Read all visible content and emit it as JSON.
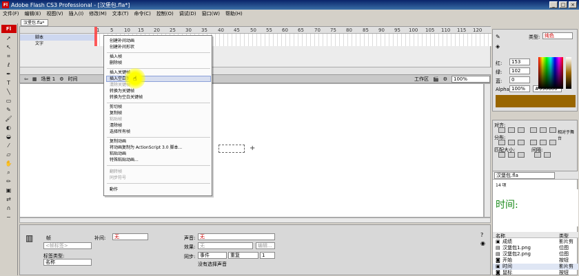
{
  "app": {
    "title": "Adobe Flash CS3 Professional - [汉堡包.fla*]",
    "logo": "Fl",
    "window_buttons": [
      "_",
      "□",
      "×"
    ]
  },
  "menubar": [
    "文件(F)",
    "编辑(E)",
    "视图(V)",
    "插入(I)",
    "修改(M)",
    "文本(T)",
    "命令(C)",
    "控制(O)",
    "调试(D)",
    "窗口(W)",
    "帮助(H)"
  ],
  "document_tab": "汉堡包.fla*",
  "timeline": {
    "frame_numbers": [
      "1",
      "5",
      "10",
      "15",
      "20",
      "25",
      "30",
      "35",
      "40",
      "45",
      "50",
      "55",
      "60",
      "65",
      "70",
      "75",
      "80",
      "85",
      "90",
      "95",
      "100",
      "105",
      "110",
      "115",
      "120"
    ],
    "layers": [
      "脚本",
      "文字"
    ]
  },
  "scene": {
    "back_label": "",
    "scene_label": "场景 1",
    "frame_label": "时间",
    "workspace_label": "工作区",
    "zoom": "100%"
  },
  "context_menu": {
    "groups": [
      [
        {
          "label": "创建补间动画",
          "enabled": true
        },
        {
          "label": "创建补间形状",
          "enabled": true
        }
      ],
      [
        {
          "label": "插入帧",
          "enabled": true
        },
        {
          "label": "删除帧",
          "enabled": true
        }
      ],
      [
        {
          "label": "插入关键帧",
          "enabled": true
        },
        {
          "label": "插入空白关键帧",
          "enabled": true
        },
        {
          "label": "清除关键帧",
          "enabled": false
        },
        {
          "label": "转换为关键帧",
          "enabled": true
        },
        {
          "label": "转换为空白关键帧",
          "enabled": true
        }
      ],
      [
        {
          "label": "剪切帧",
          "enabled": true
        },
        {
          "label": "复制帧",
          "enabled": true
        },
        {
          "label": "粘贴帧",
          "enabled": false
        },
        {
          "label": "清除帧",
          "enabled": true
        },
        {
          "label": "选择所有帧",
          "enabled": true
        }
      ],
      [
        {
          "label": "复制动画",
          "enabled": true
        },
        {
          "label": "将动画复制为 ActionScript 3.0 脚本...",
          "enabled": true
        },
        {
          "label": "粘贴动画",
          "enabled": true
        },
        {
          "label": "特殊粘贴动画...",
          "enabled": true
        }
      ],
      [
        {
          "label": "翻转帧",
          "enabled": false
        },
        {
          "label": "同步符号",
          "enabled": false
        }
      ],
      [
        {
          "label": "動作",
          "enabled": true
        }
      ]
    ],
    "highlighted": "插入空白关键帧"
  },
  "properties": {
    "frame_label": "帧",
    "frame_name_placeholder": "<帧标签>",
    "tween_label": "补间:",
    "tween_value": "无",
    "label_type_label": "标签类型:",
    "label_type_value": "名称",
    "sound_label": "声音:",
    "sound_value": "无",
    "effect_label": "效果:",
    "effect_value": "无",
    "edit_button": "编辑...",
    "sync_label": "同步:",
    "sync_event": "事件",
    "sync_repeat": "重复",
    "repeat_count": "1",
    "no_sound": "没有选择声音"
  },
  "color_panel": {
    "type_label": "类型:",
    "type_value": "纯色",
    "red_label": "红:",
    "red_value": "153",
    "green_label": "绿:",
    "green_value": "102",
    "blue_label": "蓝:",
    "blue_value": "0",
    "alpha_label": "Alpha:",
    "alpha_value": "100%",
    "hex": "#996600"
  },
  "align_panel": {
    "align_label": "对齐:",
    "distribute_label": "分布:",
    "size_label": "匹配大小:",
    "spacing_label": "间隔:",
    "relative_label": "相对于舞台"
  },
  "library": {
    "document": "汉堡包.fla",
    "count": "14 项",
    "preview_text": "时间:",
    "col_name": "名称",
    "col_type": "类型",
    "items": [
      {
        "name": "成绩",
        "type": "影片剪"
      },
      {
        "name": "汉堡包1.png",
        "type": "位图"
      },
      {
        "name": "汉堡包2.png",
        "type": "位图"
      },
      {
        "name": "开始",
        "type": "按钮"
      },
      {
        "name": "时间",
        "type": "影片剪"
      },
      {
        "name": "鼠标",
        "type": "按钮"
      }
    ]
  },
  "colors": {
    "swatch": "#996600",
    "titlebar": "#0a246a",
    "highlight": "#8aa0d8",
    "preview_text": "#1a8a1a"
  }
}
